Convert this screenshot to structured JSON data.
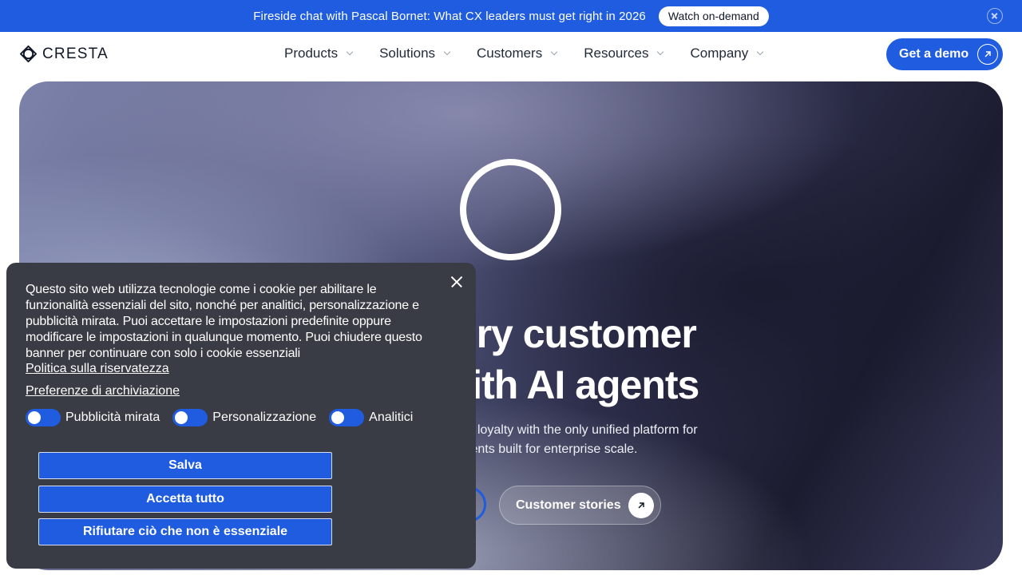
{
  "announcement": {
    "text": "Fireside chat with Pascal Bornet: What CX leaders must get right in 2026",
    "button_label": "Watch on-demand"
  },
  "nav": {
    "logo_text": "CRESTA",
    "items": [
      {
        "label": "Products"
      },
      {
        "label": "Solutions"
      },
      {
        "label": "Customers"
      },
      {
        "label": "Resources"
      },
      {
        "label": "Company"
      }
    ],
    "cta_label": "Get a demo"
  },
  "hero": {
    "headline_line1": "every customer",
    "headline_line2": "e with AI agents",
    "sub_line1": "d customer loyalty with the only unified platform for",
    "sub_line2": "ents built for enterprise scale.",
    "secondary_cta_label": "Customer stories"
  },
  "cookie_banner": {
    "text": "Questo sito web utilizza tecnologie come i cookie per abilitare le funzionalità essenziali del sito, nonché per analitici, personalizzazione e pubblicità mirata. Puoi accettare le impostazioni predefinite oppure modificare le impostazioni in qualunque momento. Puoi chiudere questo banner per continuare con solo i cookie essenziali",
    "privacy_link": "Politica sulla riservatezza",
    "preferences_link": "Preferenze di archiviazione",
    "toggles": [
      {
        "label": "Pubblicità mirata",
        "on": true
      },
      {
        "label": "Personalizzazione",
        "on": true
      },
      {
        "label": "Analitici",
        "on": true
      }
    ],
    "buttons": {
      "save": "Salva",
      "accept_all": "Accetta tutto",
      "reject": "Rifiutare ciò che non è essenziale"
    }
  },
  "colors": {
    "brand_blue": "#1f5ce0",
    "banner_bg": "#3a3c45"
  }
}
